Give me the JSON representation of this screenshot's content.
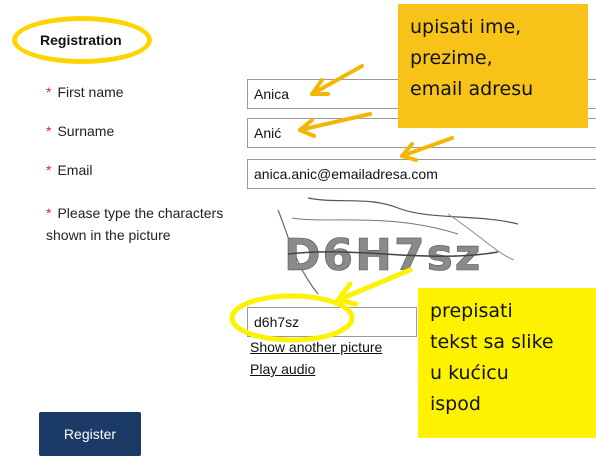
{
  "form": {
    "title": "Registration",
    "required_marker": "*",
    "first_name": {
      "label": "First name",
      "value": "Anica"
    },
    "surname": {
      "label": "Surname",
      "value": "Anić"
    },
    "email": {
      "label": "Email",
      "value": "anica.anic@emailadresa.com"
    },
    "captcha": {
      "label_line1": "Please type the characters",
      "label_line2": "shown in the picture",
      "image_text": "D6H7sz",
      "value": "d6h7sz",
      "show_another_label": "Show another picture",
      "play_audio_label": "Play audio"
    },
    "register_label": "Register"
  },
  "annotations": {
    "top_note": [
      "upisati ime,",
      "prezime,",
      "email adresu"
    ],
    "bottom_note": [
      "prepisati",
      "tekst sa slike",
      "u kućicu",
      "ispod"
    ],
    "note_colors": {
      "top": "#f7c318",
      "bottom": "#fff200",
      "circle": "#ffd400"
    }
  }
}
